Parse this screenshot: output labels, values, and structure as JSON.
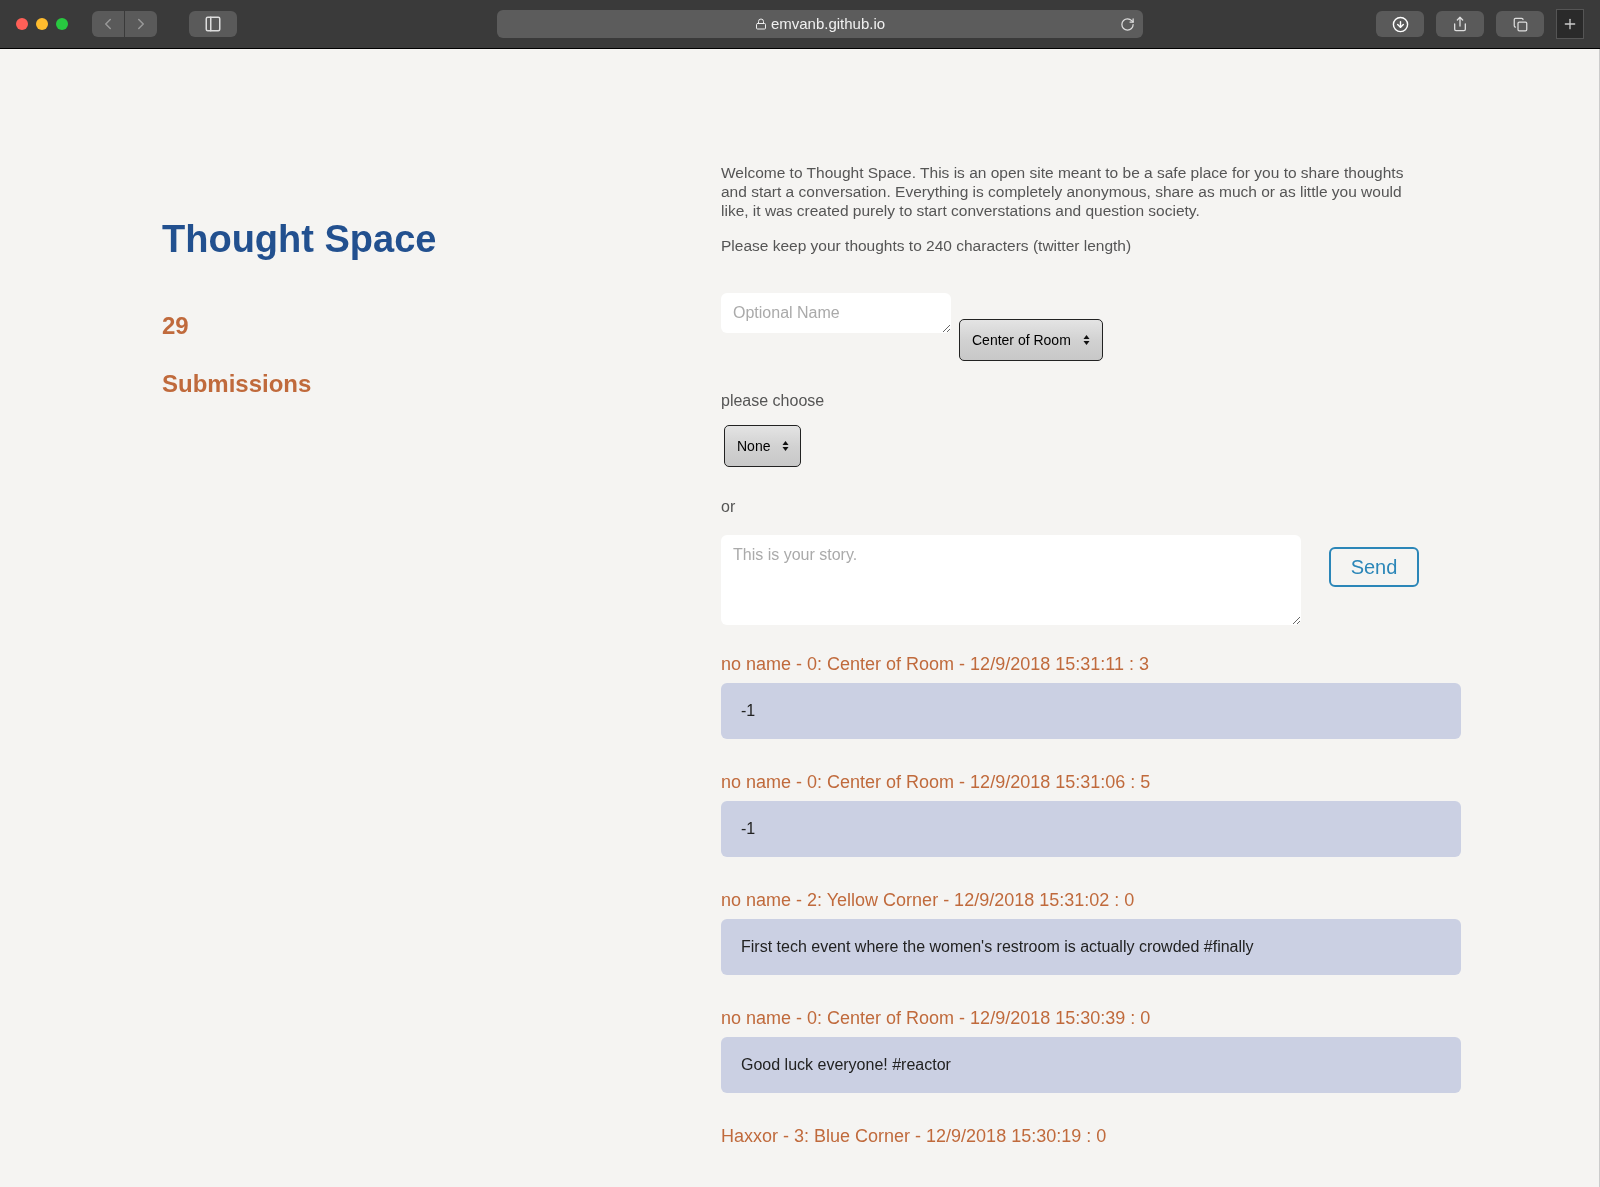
{
  "browser": {
    "url": "emvanb.github.io"
  },
  "sidebar": {
    "title": "Thought Space",
    "count": "29",
    "count_label": "Submissions"
  },
  "intro": {
    "paragraphs": [
      "Welcome to Thought Space. This is an open site meant to be a safe place for you to share thoughts and start a conversation. Everything is completely anonymous, share as much or as little you would like, it was created purely to start converstations and question society.",
      "Please keep your thoughts to 240 characters (twitter length)"
    ]
  },
  "form": {
    "name_field": {
      "placeholder": "Optional Name"
    },
    "location_select": {
      "value": "Center of Room"
    },
    "choose_label": "please choose",
    "choice_select": {
      "value": "None"
    },
    "or_label": "or",
    "story_field": {
      "placeholder": "This is your story."
    },
    "send_button": "Send"
  },
  "posts": [
    {
      "header": "no name - 0: Center of Room - 12/9/2018 15:31:11 : 3",
      "body": "-1"
    },
    {
      "header": "no name - 0: Center of Room - 12/9/2018 15:31:06 : 5",
      "body": "-1"
    },
    {
      "header": "no name - 2: Yellow Corner - 12/9/2018 15:31:02 : 0",
      "body": "First tech event where the women's restroom is actually crowded #finally"
    },
    {
      "header": "no name - 0: Center of Room - 12/9/2018 15:30:39 : 0",
      "body": "Good luck everyone! #reactor"
    },
    {
      "header": "Haxxor - 3: Blue Corner - 12/9/2018 15:30:19 : 0"
    }
  ]
}
